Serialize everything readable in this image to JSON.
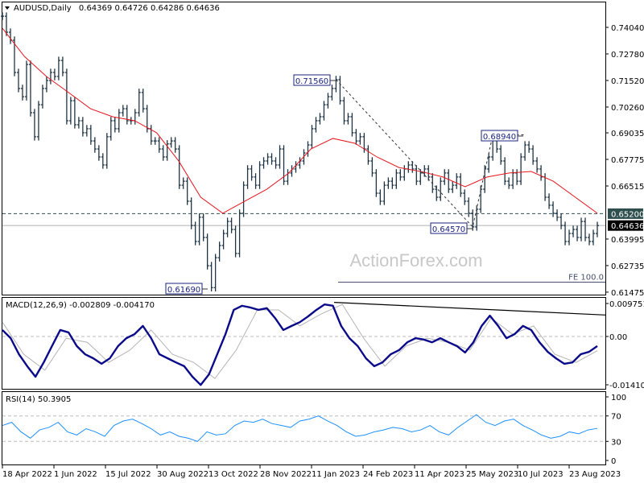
{
  "chart_data": [
    {
      "type": "ohlc",
      "title": "AUDUSD,Daily",
      "ohlc_readout": "0.64369 0.64726 0.64286 0.64636",
      "ylim": [
        0.61475,
        0.7404
      ],
      "y_ticks": [
        "0.74040",
        "0.72780",
        "0.71520",
        "0.70260",
        "0.69035",
        "0.67775",
        "0.66515",
        "0.63995",
        "0.62735",
        "0.61475"
      ],
      "x_tick_labels": [
        "18 Apr 2022",
        "1 Jun 2022",
        "15 Jul 2022",
        "30 Aug 2022",
        "13 Oct 2022",
        "28 Nov 2022",
        "11 Jan 2023",
        "24 Feb 2023",
        "11 Apr 2023",
        "25 May 2023",
        "10 Jul 2023",
        "23 Aug 2023"
      ],
      "close": [
        0.7457,
        0.7381,
        0.7343,
        0.719,
        0.7114,
        0.7075,
        0.7228,
        0.6999,
        0.6885,
        0.7037,
        0.7114,
        0.7152,
        0.719,
        0.7171,
        0.7247,
        0.719,
        0.6961,
        0.7056,
        0.6942,
        0.6961,
        0.6904,
        0.6923,
        0.6865,
        0.6827,
        0.6789,
        0.6751,
        0.6885,
        0.6961,
        0.6923,
        0.6999,
        0.7018,
        0.6961,
        0.6961,
        0.6999,
        0.7095,
        0.7018,
        0.6923,
        0.6865,
        0.6865,
        0.6827,
        0.6789,
        0.6851,
        0.6865,
        0.6827,
        0.6655,
        0.6674,
        0.6579,
        0.6464,
        0.6388,
        0.6503,
        0.6407,
        0.6273,
        0.6169,
        0.6311,
        0.6369,
        0.6426,
        0.6483,
        0.6445,
        0.6331,
        0.6522,
        0.6655,
        0.6732,
        0.6694,
        0.6655,
        0.6751,
        0.677,
        0.6789,
        0.677,
        0.6751,
        0.6827,
        0.6674,
        0.6713,
        0.6732,
        0.6751,
        0.677,
        0.6808,
        0.6846,
        0.6923,
        0.6961,
        0.698,
        0.7037,
        0.7075,
        0.7114,
        0.7156,
        0.7056,
        0.6961,
        0.698,
        0.6904,
        0.6865,
        0.6885,
        0.6827,
        0.677,
        0.6713,
        0.6617,
        0.6579,
        0.6655,
        0.6674,
        0.6655,
        0.6713,
        0.6694,
        0.6732,
        0.6751,
        0.6732,
        0.6674,
        0.6713,
        0.6732,
        0.6694,
        0.6636,
        0.6598,
        0.6674,
        0.6713,
        0.6636,
        0.6655,
        0.6694,
        0.6617,
        0.6579,
        0.6522,
        0.6457,
        0.6541,
        0.6636,
        0.6732,
        0.6789,
        0.6894,
        0.6827,
        0.677,
        0.6674,
        0.6655,
        0.6713,
        0.6674,
        0.6789,
        0.6846,
        0.6827,
        0.677,
        0.6732,
        0.6694,
        0.6598,
        0.656,
        0.6522,
        0.6503,
        0.6464,
        0.6388,
        0.6426,
        0.6445,
        0.6407,
        0.6483,
        0.6407,
        0.6388,
        0.6426,
        0.64636
      ],
      "ma_line": [
        0.74,
        0.7266,
        0.7171,
        0.7095,
        0.7018,
        0.698,
        0.6961,
        0.6904,
        0.677,
        0.6598,
        0.6522,
        0.6579,
        0.6636,
        0.6713,
        0.6827,
        0.6877,
        0.6854,
        0.6789,
        0.6739,
        0.672,
        0.6694,
        0.6648,
        0.6694,
        0.6713,
        0.672,
        0.6674,
        0.6598,
        0.6522
      ],
      "hline_dashed": {
        "value": 0.652,
        "label": "0.65200"
      },
      "current_price": {
        "value": 0.64636,
        "label": "0.64636"
      },
      "fe_line": {
        "value": 0.6195,
        "label": "FE 100.0"
      },
      "annotations": [
        {
          "label": "0.71560",
          "value": 0.7156
        },
        {
          "label": "0.68940",
          "value": 0.6894
        },
        {
          "label": "0.64570",
          "value": 0.6457
        },
        {
          "label": "0.61690",
          "value": 0.6169
        }
      ],
      "watermark": "ActionForex.com",
      "colors": {
        "bars": "#1f3545",
        "ma": "#e8141c",
        "label_border": "#1a237e",
        "dashed": "#2f4f4f",
        "current_bg": "#000000",
        "level_bg": "#2f4f4f"
      }
    },
    {
      "type": "line",
      "title": "MACD(12,26,9) -0.002809 -0.004170",
      "ylim": [
        -0.014107,
        0.009751
      ],
      "y_ticks": [
        "0.009751",
        "0.00",
        "-0.014107"
      ],
      "macd": [
        0.0019,
        -0.0005,
        -0.0052,
        -0.0087,
        -0.0118,
        -0.0076,
        -0.0028,
        0.0019,
        0.0012,
        -0.0028,
        -0.0052,
        -0.0064,
        -0.008,
        -0.0064,
        -0.0028,
        -0.0005,
        0.0007,
        0.0031,
        -0.0005,
        -0.0052,
        -0.0064,
        -0.0076,
        -0.0087,
        -0.0118,
        -0.0142,
        -0.0111,
        -0.0052,
        0.0007,
        0.0078,
        0.009,
        0.0085,
        0.0078,
        0.0083,
        0.0054,
        0.0019,
        0.0031,
        0.0042,
        0.0059,
        0.0078,
        0.0094,
        0.009,
        0.0031,
        -0.0005,
        -0.0028,
        -0.0064,
        -0.0087,
        -0.0076,
        -0.0052,
        -0.004,
        -0.0017,
        -0.0005,
        -0.0009,
        -0.0017,
        -0.0005,
        -0.0017,
        -0.0028,
        -0.0047,
        -0.0017,
        0.0031,
        0.0061,
        0.0031,
        -0.0005,
        0.0007,
        0.0031,
        0.0019,
        -0.0017,
        -0.0045,
        -0.0064,
        -0.008,
        -0.0076,
        -0.0052,
        -0.0045,
        -0.002809
      ],
      "signal": [
        0.0042,
        -0.0052,
        -0.0099,
        -0.0005,
        -0.0017,
        -0.0076,
        -0.004,
        0.0019,
        -0.0052,
        -0.0076,
        -0.0123,
        -0.004,
        0.0078,
        0.0078,
        0.0031,
        0.0066,
        0.0094,
        -0.0005,
        -0.0087,
        -0.0028,
        -0.0005,
        -0.0017,
        -0.004,
        0.0054,
        0.0007,
        0.0031,
        -0.0052,
        -0.0076,
        -0.00417
      ],
      "trendline": [
        0.01,
        0.0063
      ],
      "colors": {
        "macd": "#0a0a8a",
        "signal": "#b4b4b4",
        "trendline": "#000000"
      }
    },
    {
      "type": "line",
      "title": "RSI(14) 50.3905",
      "ylim": [
        0,
        100
      ],
      "y_ticks": [
        "100",
        "70",
        "30",
        "0"
      ],
      "levels": [
        70,
        30
      ],
      "rsi": [
        55,
        60,
        45,
        35,
        48,
        52,
        60,
        45,
        40,
        50,
        45,
        38,
        55,
        62,
        65,
        58,
        50,
        40,
        45,
        38,
        35,
        30,
        45,
        40,
        42,
        55,
        62,
        60,
        65,
        58,
        55,
        52,
        62,
        65,
        70,
        62,
        55,
        45,
        38,
        40,
        45,
        48,
        52,
        50,
        45,
        48,
        55,
        45,
        40,
        52,
        62,
        72,
        60,
        55,
        62,
        65,
        55,
        48,
        40,
        35,
        38,
        45,
        42,
        48,
        50.3905
      ],
      "colors": {
        "rsi": "#1e90ff"
      }
    }
  ]
}
